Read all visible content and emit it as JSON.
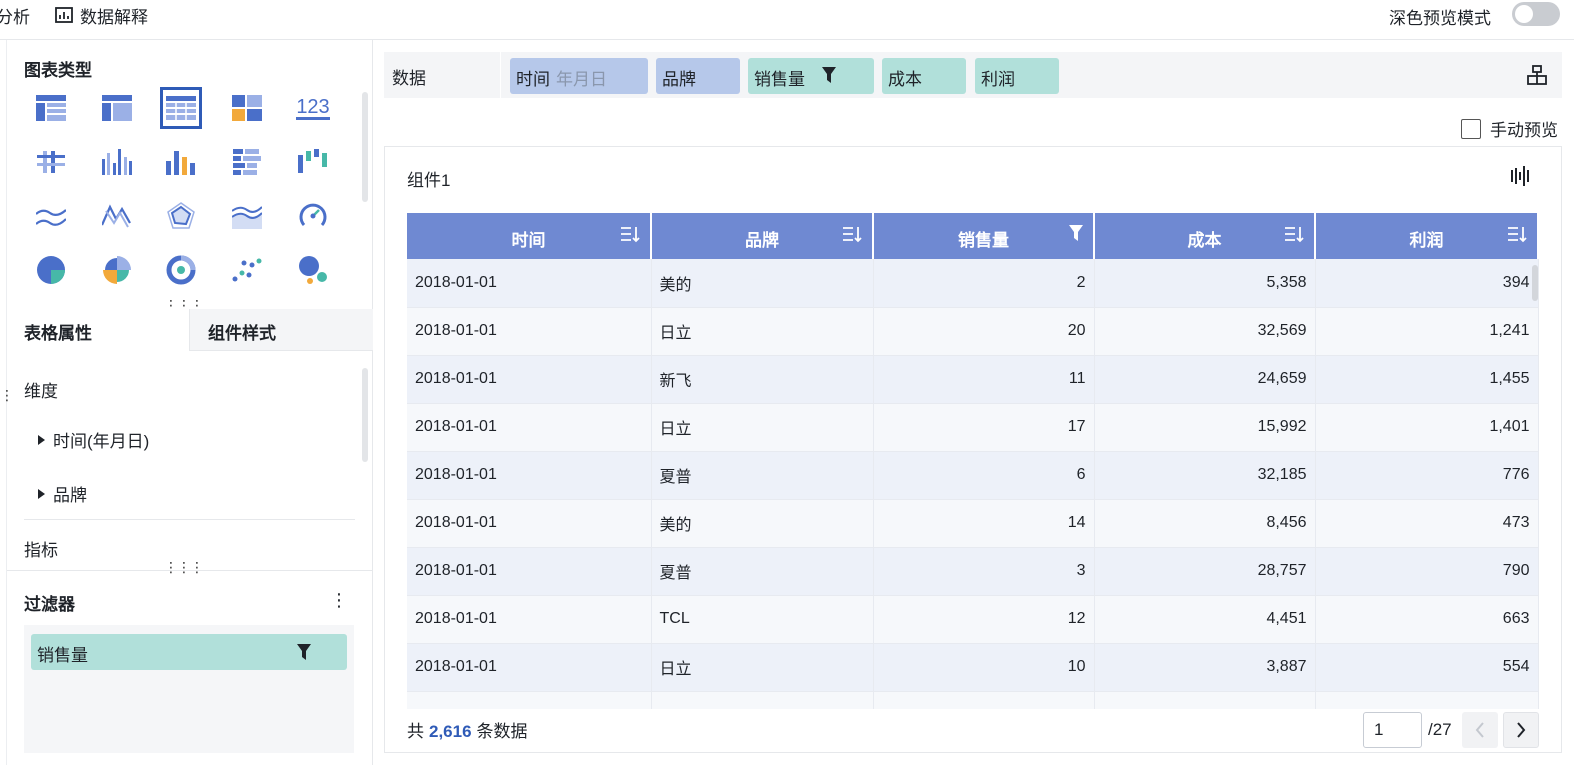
{
  "topbar": {
    "tab_partial": "分析",
    "explain_label": "数据解释",
    "dark_mode_label": "深色预览模式"
  },
  "left": {
    "chart_types_title": "图表类型",
    "chart_icons": [
      "table-icon",
      "cross-table-icon",
      "detail-table-icon",
      "treemap-icon",
      "kpi-number-icon",
      "grouped-bar-h-icon",
      "grouped-column-icon",
      "column-icon",
      "stacked-bar-h-icon",
      "waterfall-icon",
      "line-icon",
      "stock-line-icon",
      "radar-icon",
      "area-icon",
      "gauge-icon",
      "pie-icon",
      "rose-icon",
      "ring-icon",
      "scatter-icon",
      "bubble-icon"
    ],
    "kpi_glyph": "123",
    "tab_table_props": "表格属性",
    "tab_component_style": "组件样式",
    "dimension_label": "维度",
    "dimensions": [
      "时间(年月日)",
      "品牌"
    ],
    "metric_label": "指标",
    "filter_title": "过滤器",
    "filter_chip": "销售量"
  },
  "datarow": {
    "label": "数据",
    "pills": [
      {
        "text": "时间",
        "sub": "年月日",
        "kind": "dim"
      },
      {
        "text": "品牌",
        "sub": "",
        "kind": "dim"
      },
      {
        "text": "销售量",
        "sub": "",
        "kind": "meas"
      },
      {
        "text": "成本",
        "sub": "",
        "kind": "meas"
      },
      {
        "text": "利润",
        "sub": "",
        "kind": "meas"
      }
    ]
  },
  "manual_preview_label": "手动预览",
  "card": {
    "title": "组件1",
    "columns": [
      "时间",
      "品牌",
      "销售量",
      "成本",
      "利润"
    ],
    "rows": [
      [
        "2018-01-01",
        "美的",
        "2",
        "5,358",
        "394"
      ],
      [
        "2018-01-01",
        "日立",
        "20",
        "32,569",
        "1,241"
      ],
      [
        "2018-01-01",
        "新飞",
        "11",
        "24,659",
        "1,455"
      ],
      [
        "2018-01-01",
        "日立",
        "17",
        "15,992",
        "1,401"
      ],
      [
        "2018-01-01",
        "夏普",
        "6",
        "32,185",
        "776"
      ],
      [
        "2018-01-01",
        "美的",
        "14",
        "8,456",
        "473"
      ],
      [
        "2018-01-01",
        "夏普",
        "3",
        "28,757",
        "790"
      ],
      [
        "2018-01-01",
        "TCL",
        "12",
        "4,451",
        "663"
      ],
      [
        "2018-01-01",
        "日立",
        "10",
        "3,887",
        "554"
      ],
      [
        "",
        "",
        "",
        "",
        ""
      ]
    ],
    "footer_prefix": "共",
    "footer_count": "2,616",
    "footer_suffix": "条数据",
    "page_value": "1",
    "page_total": "/27"
  },
  "colors": {
    "header_blue": "#6f89d2",
    "dim_pill": "#b6c8ea",
    "measure_pill": "#b1e0da",
    "accent": "#2f5bb7"
  }
}
